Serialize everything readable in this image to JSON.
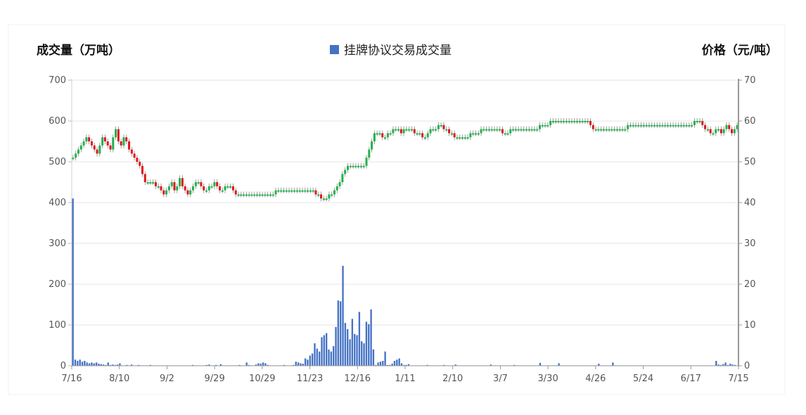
{
  "chart_data": {
    "type": "bar+candlestick",
    "left_axis_title": "成交量（万吨）",
    "right_axis_title": "价格（元/吨）",
    "legend": [
      {
        "label": "挂牌协议交易成交量",
        "color": "#4472c4"
      }
    ],
    "x_ticks": [
      "7/16",
      "8/10",
      "9/2",
      "9/29",
      "10/29",
      "11/23",
      "12/16",
      "1/11",
      "2/10",
      "3/7",
      "3/30",
      "4/26",
      "5/24",
      "6/17",
      "7/15"
    ],
    "y_left": {
      "min": 0,
      "max": 700,
      "ticks": [
        0,
        100,
        200,
        300,
        400,
        500,
        600,
        700
      ]
    },
    "y_right": {
      "min": 0,
      "max": 70,
      "ticks": [
        0,
        10,
        20,
        30,
        40,
        50,
        60,
        70
      ]
    },
    "volume_series": {
      "name": "挂牌协议交易成交量",
      "color": "#4472c4",
      "values": [
        410,
        15,
        12,
        15,
        10,
        12,
        8,
        6,
        8,
        6,
        8,
        5,
        4,
        3,
        2,
        8,
        2,
        3,
        2,
        3,
        6,
        1,
        0,
        2,
        1,
        3,
        0,
        0,
        2,
        0,
        1,
        0,
        1,
        2,
        0,
        0,
        1,
        0,
        0,
        0,
        1,
        0,
        0,
        0,
        0,
        0,
        1,
        0,
        0,
        1,
        0,
        2,
        0,
        1,
        0,
        0,
        1,
        2,
        3,
        0,
        1,
        2,
        0,
        4,
        1,
        0,
        0,
        1,
        0,
        0,
        0,
        2,
        0,
        0,
        8,
        2,
        0,
        0,
        3,
        6,
        5,
        8,
        6,
        2,
        0,
        1,
        1,
        0,
        0,
        0,
        2,
        0,
        0,
        0,
        2,
        10,
        8,
        6,
        5,
        18,
        15,
        25,
        30,
        55,
        42,
        35,
        70,
        75,
        80,
        40,
        35,
        48,
        95,
        160,
        158,
        245,
        105,
        90,
        65,
        115,
        78,
        75,
        132,
        60,
        55,
        108,
        102,
        138,
        40,
        2,
        8,
        10,
        12,
        35,
        2,
        2,
        5,
        12,
        15,
        18,
        6,
        2,
        2,
        4,
        1,
        0,
        1,
        0,
        1,
        0,
        0,
        2,
        0,
        0,
        0,
        0,
        0,
        0,
        2,
        1,
        0,
        0,
        0,
        3,
        0,
        0,
        0,
        0,
        0,
        0,
        0,
        0,
        0,
        1,
        0,
        0,
        0,
        0,
        3,
        0,
        0,
        0,
        0,
        0,
        1,
        0,
        0,
        0,
        2,
        0,
        0,
        0,
        0,
        0,
        0,
        0,
        0,
        0,
        0,
        7,
        0,
        0,
        0,
        0,
        0,
        0,
        0,
        6,
        0,
        0,
        0,
        0,
        0,
        0,
        0,
        0,
        0,
        0,
        0,
        0,
        0,
        0,
        0,
        0,
        5,
        0,
        0,
        0,
        0,
        0,
        8,
        0,
        0,
        0,
        0,
        0,
        0,
        0,
        0,
        0,
        0,
        0,
        0,
        0,
        0,
        0,
        0,
        0,
        0,
        0,
        0,
        0,
        0,
        0,
        0,
        0,
        0,
        0,
        0,
        0,
        0,
        0,
        0,
        0,
        0,
        0,
        0,
        0,
        0,
        0,
        0,
        0,
        0,
        0,
        12,
        3,
        2,
        4,
        8,
        2,
        5,
        3,
        2,
        1
      ]
    },
    "price_series": {
      "name": "价格",
      "values": [
        51,
        52,
        53,
        54,
        55,
        56,
        55,
        54,
        53,
        52,
        54,
        56,
        55,
        54,
        53,
        56,
        58,
        55,
        54,
        56,
        55,
        53,
        52,
        51,
        50,
        49,
        47,
        45,
        45,
        45,
        45,
        44,
        44,
        43,
        42,
        43,
        44,
        45,
        43,
        44,
        46,
        44,
        43,
        42,
        43,
        44,
        45,
        45,
        44,
        43,
        43,
        44,
        44,
        45,
        44,
        43,
        43,
        44,
        44,
        44,
        43,
        42,
        42,
        42,
        42,
        42,
        42,
        42,
        42,
        42,
        42,
        42,
        42,
        42,
        42,
        42,
        43,
        43,
        43,
        43,
        43,
        43,
        43,
        43,
        43,
        43,
        43,
        43,
        43,
        43,
        43,
        42,
        42,
        41,
        41,
        41,
        42,
        42,
        43,
        44,
        45,
        47,
        48,
        49,
        49,
        49,
        49,
        49,
        49,
        49,
        51,
        53,
        55,
        57,
        57,
        57,
        56,
        56,
        57,
        57,
        58,
        58,
        58,
        57,
        58,
        58,
        58,
        58,
        57,
        57,
        57,
        56,
        56,
        57,
        58,
        58,
        58,
        59,
        59,
        58,
        58,
        57,
        57,
        56,
        56,
        56,
        56,
        56,
        56,
        57,
        57,
        57,
        57,
        58,
        58,
        58,
        58,
        58,
        58,
        58,
        58,
        57,
        57,
        57,
        58,
        58,
        58,
        58,
        58,
        58,
        58,
        58,
        58,
        58,
        58,
        59,
        59,
        59,
        59,
        60,
        60,
        60,
        60,
        60,
        60,
        60,
        60,
        60,
        60,
        60,
        60,
        60,
        60,
        60,
        59,
        58,
        58,
        58,
        58,
        58,
        58,
        58,
        58,
        58,
        58,
        58,
        58,
        58,
        59,
        59,
        59,
        59,
        59,
        59,
        59,
        59,
        59,
        59,
        59,
        59,
        59,
        59,
        59,
        59,
        59,
        59,
        59,
        59,
        59,
        59,
        59,
        59,
        59,
        60,
        60,
        60,
        59,
        58,
        58,
        57,
        57,
        58,
        58,
        57,
        58,
        59,
        58,
        57,
        58,
        59
      ]
    }
  }
}
